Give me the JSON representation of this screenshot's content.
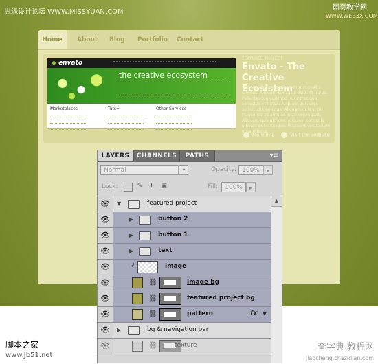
{
  "watermarks": {
    "top_left": "思缘设计论坛 WWW.MISSYUAN.COM",
    "top_right_line1": "网页教学网",
    "top_right_line2": "WWW.WEB3X.COM",
    "bottom_left_name": "脚本之家",
    "bottom_left_url": "www.Jb51.net",
    "bottom_right_name": "查字典 教程网",
    "bottom_right_url": "jiaocheng.chazidian.com"
  },
  "site": {
    "nav": [
      "Home",
      "About",
      "Blog",
      "Portfolio",
      "Contact"
    ],
    "feature": {
      "label": "FEATURED PROJECT",
      "title": "Envato - The Creative Ecosistem",
      "description": "Sed ut odio fermentum enim convallis ultrices. Aliquam convallis dolor et purus. Pellentesque euismod nunc tristique senectus et netus. Aliquam quis arcu sollicitudin egestas. Aliquam quis arcu. Maecenas ac ante ac justo consequat. Aliquam quis ultrices. Aliquam convallis ultrices pellentesque. Praesent vestibulum ornare lacus.",
      "more_info": "More info",
      "visit": "Visit the website",
      "screenshot": {
        "logo_prefix": "",
        "logo": "envato",
        "tagline": "the creative ecosystem",
        "columns": [
          "Marketplaces",
          "Tuts+",
          "Other Services"
        ]
      }
    }
  },
  "panel": {
    "tabs": [
      "LAYERS",
      "CHANNELS",
      "PATHS"
    ],
    "blend_mode": "Normal",
    "opacity_label": "Opacity:",
    "opacity_value": "100%",
    "lock_label": "Lock:",
    "fill_label": "Fill:",
    "fill_value": "100%",
    "layers": [
      {
        "name": "featured project",
        "kind": "group",
        "expanded": true,
        "indent": 0
      },
      {
        "name": "button 2",
        "kind": "group",
        "expanded": false,
        "indent": 1
      },
      {
        "name": "button 1",
        "kind": "group",
        "expanded": false,
        "indent": 1
      },
      {
        "name": "text",
        "kind": "group",
        "expanded": false,
        "indent": 1
      },
      {
        "name": "image",
        "kind": "smart",
        "indent": 1
      },
      {
        "name": "image bg",
        "kind": "shape",
        "color": "#a39b46",
        "indent": 1
      },
      {
        "name": "featured project bg",
        "kind": "shape",
        "color": "#a7a34a",
        "indent": 1
      },
      {
        "name": "pattern",
        "kind": "shape",
        "color": "#c3c08a",
        "indent": 1,
        "fx": "fx"
      },
      {
        "name": "bg & navigation bar",
        "kind": "group",
        "expanded": false,
        "indent": 0
      },
      {
        "name": "texture",
        "kind": "shape",
        "indent": 1
      }
    ]
  },
  "colors": {
    "background_green": "#7d8f2f",
    "site_bg": "#e6e6b2",
    "selected_layer": "#a6a9bb"
  }
}
